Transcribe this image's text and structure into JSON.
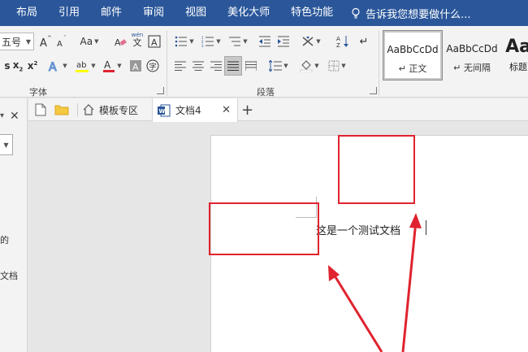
{
  "menu": {
    "tabs": [
      "布局",
      "引用",
      "邮件",
      "审阅",
      "视图",
      "美化大师",
      "特色功能"
    ],
    "tell_me": "告诉我您想要做什么..."
  },
  "ribbon": {
    "font_size": "五号",
    "change_case_label": "Aa",
    "font_group_label": "字体",
    "paragraph_group_label": "段落",
    "styles": [
      {
        "sample": "AaBbCcDd",
        "name": "正文"
      },
      {
        "sample": "AaBbCcDd",
        "name": "无间隔"
      },
      {
        "sample": "Aa",
        "name": "标题"
      }
    ],
    "phonetic_top": "wén",
    "phonetic_char": "文",
    "circle_char": "字"
  },
  "left_pane": {
    "text_1": "的",
    "text_2": "文档"
  },
  "doc_tabs": {
    "template_tab": "模板专区",
    "document_tab": "文档4",
    "close_symbol": "✕",
    "new_tab_symbol": "+"
  },
  "document": {
    "text": "这是一个测试文档"
  },
  "colors": {
    "ribbon_blue": "#2b579a",
    "annotation_red": "#e0232f",
    "highlight_yellow": "#ffff00",
    "font_color_red": "#e0232f"
  }
}
